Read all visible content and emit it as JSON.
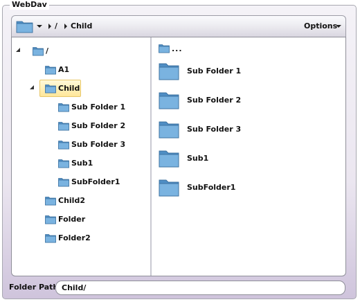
{
  "window": {
    "title": "WebDav"
  },
  "toolbar": {
    "folder_icon": "folder-icon",
    "dropdown_icon": "chevron-down-icon",
    "breadcrumb": [
      {
        "label": "/"
      },
      {
        "label": "Child"
      }
    ],
    "options_label": "Options"
  },
  "tree": {
    "root": {
      "label": "/",
      "expanded": true
    },
    "items": [
      {
        "label": "A1",
        "level": 1,
        "expanded": false,
        "selected": false
      },
      {
        "label": "Child",
        "level": 1,
        "expanded": true,
        "selected": true
      },
      {
        "label": "Sub Folder 1",
        "level": 2
      },
      {
        "label": "Sub Folder 2",
        "level": 2
      },
      {
        "label": "Sub Folder 3",
        "level": 2
      },
      {
        "label": "Sub1",
        "level": 2
      },
      {
        "label": "SubFolder1",
        "level": 2
      },
      {
        "label": "Child2",
        "level": 1
      },
      {
        "label": "Folder",
        "level": 1
      },
      {
        "label": "Folder2",
        "level": 1
      }
    ]
  },
  "list": {
    "up_label": "...",
    "items": [
      {
        "label": "Sub Folder 1"
      },
      {
        "label": "Sub Folder 2"
      },
      {
        "label": "Sub Folder 3"
      },
      {
        "label": "Sub1"
      },
      {
        "label": "SubFolder1"
      }
    ]
  },
  "footer": {
    "path_label": "Folder Path",
    "path_value": "Child/"
  },
  "colors": {
    "folder_blue": "#6fa8d6",
    "selection_yellow": "#ffe79a"
  }
}
